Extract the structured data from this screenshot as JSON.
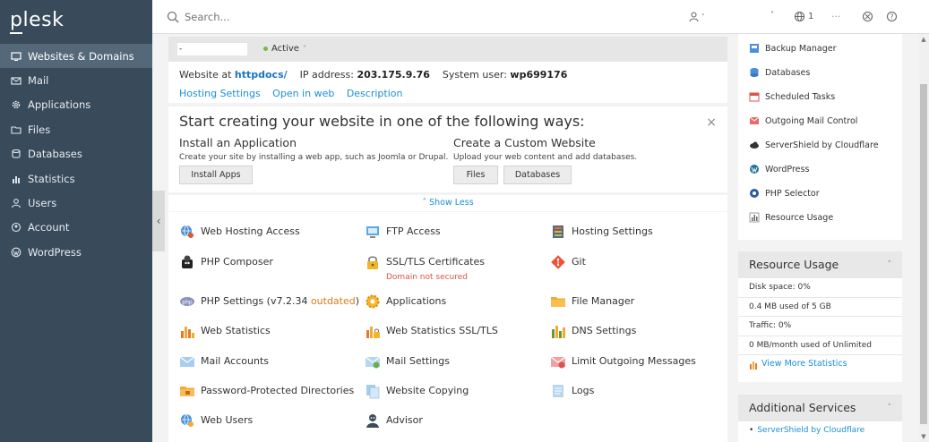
{
  "sidebar": {
    "logo": "plesk",
    "items": [
      {
        "label": "Websites & Domains",
        "icon": "monitor-icon"
      },
      {
        "label": "Mail",
        "icon": "mail-icon"
      },
      {
        "label": "Applications",
        "icon": "gear-icon"
      },
      {
        "label": "Files",
        "icon": "folder-icon"
      },
      {
        "label": "Databases",
        "icon": "database-icon"
      },
      {
        "label": "Statistics",
        "icon": "bar-chart-icon"
      },
      {
        "label": "Users",
        "icon": "user-icon"
      },
      {
        "label": "Account",
        "icon": "account-icon"
      },
      {
        "label": "WordPress",
        "icon": "wordpress-icon"
      }
    ]
  },
  "header": {
    "search_placeholder": "Search...",
    "counter": "1"
  },
  "domain": {
    "name": "-",
    "status": "Active"
  },
  "info": {
    "website_at_label": "Website at",
    "website_at_value": "httpdocs/",
    "ip_label": "IP address:",
    "ip_value": "203.175.9.76",
    "sysuser_label": "System user:",
    "sysuser_value": "wp699176",
    "links": [
      "Hosting Settings",
      "Open in web",
      "Description"
    ]
  },
  "start": {
    "title": "Start creating your website in one of the following ways:",
    "install_heading": "Install an Application",
    "install_desc": "Create your site by installing a web app, such as Joomla or Drupal.",
    "install_button": "Install Apps",
    "custom_heading": "Create a Custom Website",
    "custom_desc": "Upload your web content and add databases.",
    "files_button": "Files",
    "databases_button": "Databases",
    "show_less": "Show Less"
  },
  "tools": {
    "web_hosting_access": "Web Hosting Access",
    "ftp_access": "FTP Access",
    "hosting_settings": "Hosting Settings",
    "php_composer": "PHP Composer",
    "ssl_certificates": "SSL/TLS Certificates",
    "ssl_sub": "Domain not secured",
    "git": "Git",
    "php_settings": "PHP Settings (v7.2.34",
    "php_outdated": "outdated",
    "php_close": ")",
    "applications": "Applications",
    "file_manager": "File Manager",
    "web_statistics": "Web Statistics",
    "web_statistics_ssl": "Web Statistics SSL/TLS",
    "dns_settings": "DNS Settings",
    "mail_accounts": "Mail Accounts",
    "mail_settings": "Mail Settings",
    "limit_outgoing": "Limit Outgoing Messages",
    "password_dirs": "Password-Protected Directories",
    "website_copying": "Website Copying",
    "logs": "Logs",
    "web_users": "Web Users",
    "advisor": "Advisor"
  },
  "right_list": [
    "Backup Manager",
    "Databases",
    "Scheduled Tasks",
    "Outgoing Mail Control",
    "ServerShield by Cloudflare",
    "WordPress",
    "PHP Selector",
    "Resource Usage"
  ],
  "resource_usage": {
    "title": "Resource Usage",
    "disk": "Disk space: 0%",
    "disk_detail": "0.4 MB used of 5 GB",
    "traffic": "Traffic: 0%",
    "traffic_detail": "0 MB/month used of Unlimited",
    "more_link": "View More Statistics"
  },
  "additional_services": {
    "title": "Additional Services",
    "item": "ServerShield by Cloudflare"
  },
  "colors": {
    "sidebar_bg": "#394a5a",
    "active_item": "#55687a",
    "link": "#1a8fd6",
    "status_active": "#6fbf44"
  }
}
